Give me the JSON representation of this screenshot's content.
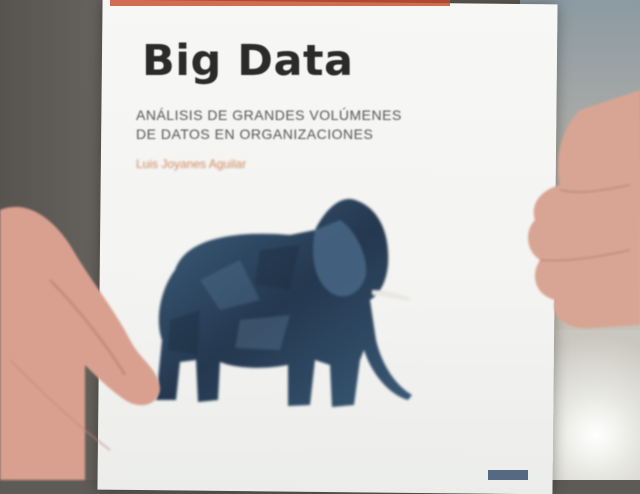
{
  "cover": {
    "title": "Big Data",
    "subtitle_line1": "ANÁLISIS DE GRANDES VOLÚMENES",
    "subtitle_line2": "DE DATOS EN ORGANIZACIONES",
    "author": "Luis Joyanes Aguilar"
  },
  "colors": {
    "title_text": "#2b2b2b",
    "author_text": "#d08a60",
    "elephant": "#2e4a66",
    "cover_bg": "#f5f5f3",
    "skin": "#d9a08f"
  },
  "icons": [
    "elephant-illustration"
  ]
}
